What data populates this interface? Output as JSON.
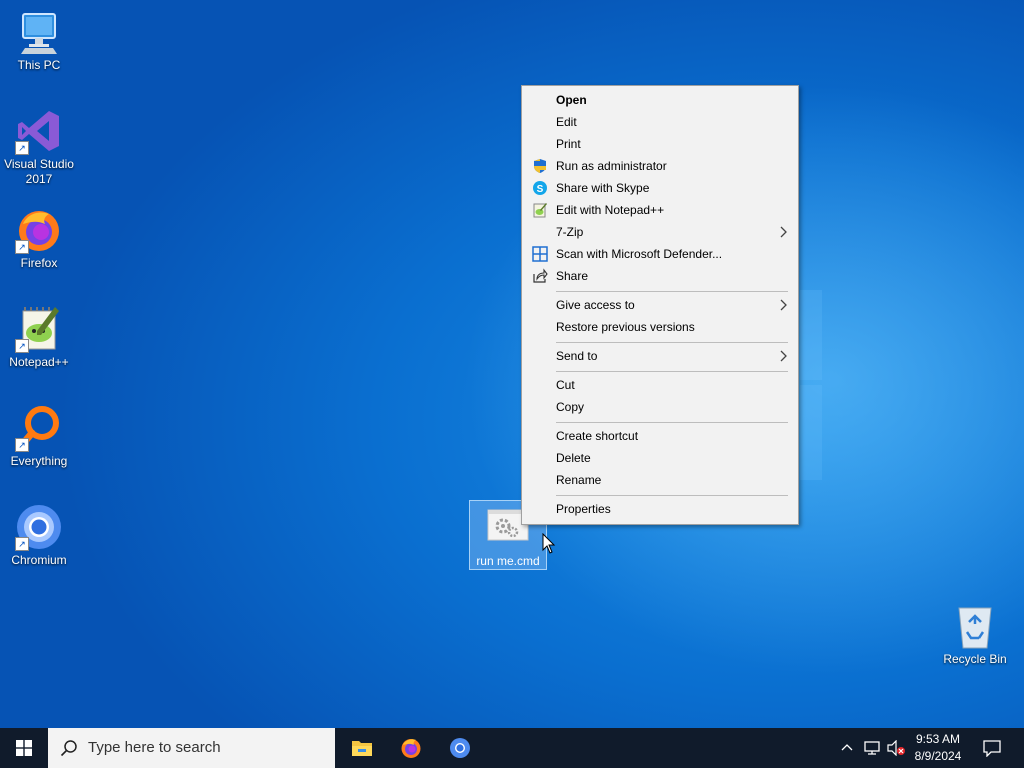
{
  "desktop": {
    "icons": [
      {
        "label": "This PC",
        "icon": "computer-icon"
      },
      {
        "label": "Visual Studio 2017",
        "icon": "visual-studio-icon"
      },
      {
        "label": "Firefox",
        "icon": "firefox-icon"
      },
      {
        "label": "Notepad++",
        "icon": "notepad-plus-plus-icon"
      },
      {
        "label": "Everything",
        "icon": "search-magnifier-icon"
      },
      {
        "label": "Chromium",
        "icon": "chromium-icon"
      }
    ],
    "recycle_bin": {
      "label": "Recycle Bin",
      "icon": "recycle-bin-icon"
    },
    "selected_file": {
      "label": "run me.cmd",
      "icon": "gears-file-icon"
    }
  },
  "context_menu": {
    "items": [
      {
        "label": "Open",
        "bold": true
      },
      {
        "label": "Edit"
      },
      {
        "label": "Print"
      },
      {
        "label": "Run as administrator",
        "icon": "uac-shield-icon"
      },
      {
        "label": "Share with Skype",
        "icon": "skype-icon"
      },
      {
        "label": "Edit with Notepad++",
        "icon": "notepad-plus-plus-icon"
      },
      {
        "label": "7-Zip",
        "submenu": true
      },
      {
        "label": "Scan with Microsoft Defender...",
        "icon": "defender-icon"
      },
      {
        "label": "Share",
        "icon": "share-icon"
      },
      {
        "label": "Give access to",
        "submenu": true
      },
      {
        "label": "Restore previous versions"
      },
      {
        "label": "Send to",
        "submenu": true
      },
      {
        "label": "Cut"
      },
      {
        "label": "Copy"
      },
      {
        "label": "Create shortcut"
      },
      {
        "label": "Delete"
      },
      {
        "label": "Rename"
      },
      {
        "label": "Properties"
      }
    ],
    "submenu_arrow": ">"
  },
  "taskbar": {
    "search_placeholder": "Type here to search",
    "pinned": [
      "file-explorer-icon",
      "firefox-icon",
      "chromium-icon"
    ],
    "tray": {
      "time": "9:53 AM",
      "date": "8/9/2024",
      "icons": [
        "chevron-up-icon",
        "network-icon",
        "volume-muted-icon",
        "notification-icon"
      ]
    }
  },
  "colors": {
    "desktop_blue": "#0a6fd0",
    "taskbar": "#101b2b",
    "menu_bg": "#f2f2f2"
  }
}
